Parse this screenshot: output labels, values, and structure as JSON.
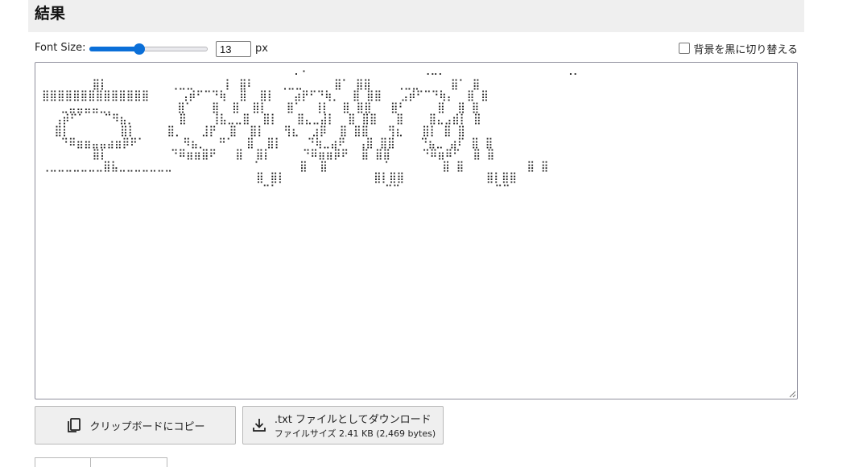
{
  "section": {
    "title": "結果"
  },
  "controls": {
    "font_size_label": "Font Size:",
    "font_size_value": "13",
    "slider_fraction": 0.42,
    "unit_label": "px",
    "bg_checkbox_label": "背景を黒に切り替える",
    "bg_checkbox_checked": false
  },
  "output": {
    "text": "                                        ⠄⠂                  ⠠⠤⠄                   ⠠⠄\n        ⣿⡇          ⢀⣀⣀     ⡇ ⣿⠇    ⢀⣀⣀     ⣿⠁ ⣿⣿    ⢀⣀⣀     ⣿⠁ ⣿\n⣿⣿⣿⣿⣿⣿⣿⣿⣿⣿⣿⣿⣿⣿     ⢠⡾⠋⠉⠙⢷  ⣿  ⣿⡇   ⣴⡟⠋⠙⢷⡀  ⣿ ⣿⣿   ⣠⡾⠋⠉⠙⢷⡄  ⣿ ⣿\n   ⣀⣤⣤⣤⣤⣀⡀          ⣿⠁   ⣿  ⣿  ⣿⡇   ⣿⠁  ⢸⡇  ⣿ ⣿⣿   ⣿⠃     ⣿  ⣿ ⣿\n  ⢠⡾⠋⠁   ⠉⠻⣦⡀       ⣿    ⢸⣧⣀⣀⣿  ⣿⡇   ⣿⣄⣀⣼⡇  ⣿ ⣿⣿   ⣿    ⣿⣄⣠⣾⡇ ⣿\n  ⣿⡇        ⣿⡇     ⣿⡀   ⣸⡟  ⣿  ⣿⡇   ⢻⣆  ⣰⡿  ⣿ ⣿⣿   ⢻⣆   ⣿⡇ ⣿ ⣿\n   ⠙⠿⣶⣶⣤⣤⣴⣶⡿⠟⠁      ⠻⣦⡀  ⠛⠁  ⣿  ⣿⡇    ⠙⢷⣀⣴⠟  ⢠⣿ ⣿⣿    ⠙⣦⣀ ⣴⠏ ⣿ ⣿\n        ⣿⡇          ⠙⠿⣶⣶⣿⠟   ⣿  ⣿⡇     ⠙⠿⣶⣶⡿⠟  ⣿ ⣿⣿     ⠙⠿⣶⠿⠋  ⣿ ⣿\n⢀⣀⣀⣀⣀⣀⣀⣀⣿⣧⣀⣀⣀⣀⣀⣀⣀             ⠁      ⣿  ⣿         ⠁        ⣿ ⣿          ⣿ ⣿\n                                  ⣿ ⣿⡇              ⣿⡇⣿⣿             ⣿⡇⣿⣿\n                                   ⠉⠁                 ⠉⠉               ⠉⠉"
  },
  "buttons": {
    "copy_label": "クリップボードにコピー",
    "copy_icon": "copy-icon",
    "download_label": ".txt ファイルとしてダウンロード",
    "download_sub": "ファイルサイズ 2.41 KB (2,469 bytes)",
    "download_icon": "download-icon"
  },
  "colors": {
    "header_bg": "#efefef",
    "accent": "#0b6fd8",
    "button_bg": "#efefef"
  }
}
